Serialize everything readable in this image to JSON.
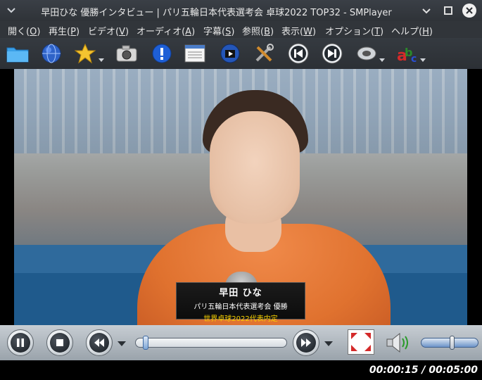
{
  "window": {
    "title": "早田ひな 優勝インタビュー | パリ五輪日本代表選考会 卓球2022 TOP32 - SMPlayer"
  },
  "menu": [
    {
      "label": "開く",
      "key": "O"
    },
    {
      "label": "再生",
      "key": "P"
    },
    {
      "label": "ビデオ",
      "key": "V"
    },
    {
      "label": "オーディオ",
      "key": "A"
    },
    {
      "label": "字幕",
      "key": "S"
    },
    {
      "label": "参照",
      "key": "B"
    },
    {
      "label": "表示",
      "key": "W"
    },
    {
      "label": "オプション",
      "key": "T"
    },
    {
      "label": "ヘルプ",
      "key": "H"
    }
  ],
  "toolbar": [
    {
      "icon": "folder-icon"
    },
    {
      "icon": "globe-icon"
    },
    {
      "icon": "star-icon"
    },
    {
      "icon": "camera-icon"
    },
    {
      "icon": "info-icon"
    },
    {
      "icon": "playlist-icon"
    },
    {
      "icon": "video-equalizer-icon"
    },
    {
      "icon": "tools-icon"
    },
    {
      "icon": "previous-icon"
    },
    {
      "icon": "next-icon"
    },
    {
      "icon": "audio-icon"
    },
    {
      "icon": "subtitle-icon"
    }
  ],
  "video": {
    "caption_name": "早田 ひな",
    "caption_line1": "パリ五輪日本代表選考会 優勝",
    "caption_line2": "世界卓球2022代表内定"
  },
  "playback": {
    "current_time": "00:00:15",
    "total_time": "00:05:00",
    "time_display": "00:00:15 / 00:05:00",
    "progress": 0.05,
    "volume": 0.55
  },
  "colors": {
    "caption_highlight": "#f5d000",
    "titlebar_bg": "#2f3338"
  }
}
